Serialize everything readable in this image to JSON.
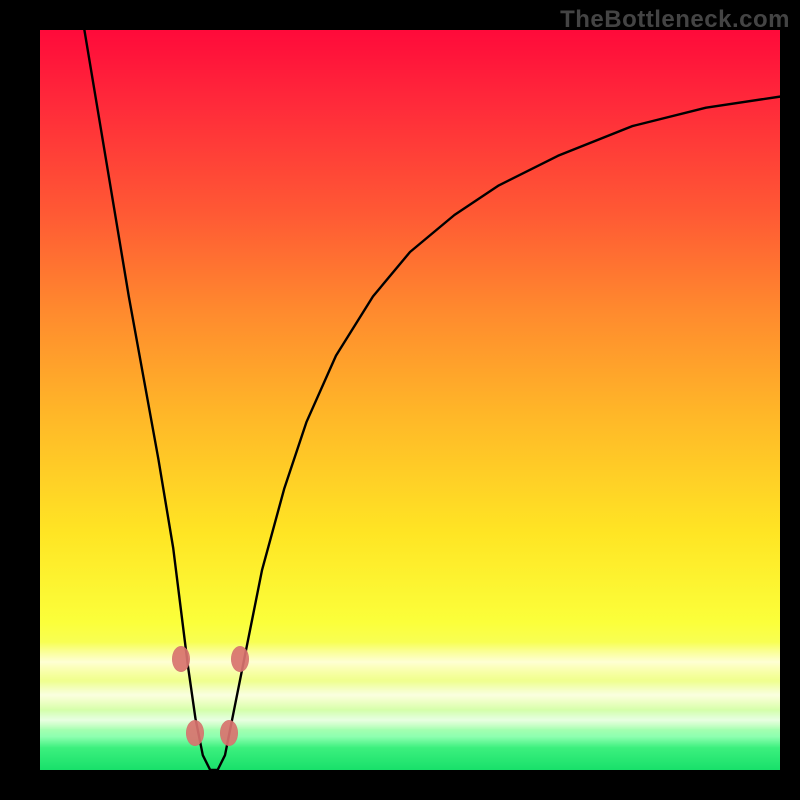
{
  "watermark": "TheBottleneck.com",
  "chart_data": {
    "type": "line",
    "title": "",
    "xlabel": "",
    "ylabel": "",
    "xlim": [
      0,
      100
    ],
    "ylim": [
      0,
      100
    ],
    "grid": false,
    "legend": false,
    "series": [
      {
        "name": "curve",
        "x": [
          6,
          8,
          10,
          12,
          14,
          16,
          18,
          19,
          20,
          21,
          22,
          23,
          24,
          25,
          26,
          28,
          30,
          33,
          36,
          40,
          45,
          50,
          56,
          62,
          70,
          80,
          90,
          100
        ],
        "y": [
          100,
          88,
          76,
          64,
          53,
          42,
          30,
          22,
          14,
          7,
          2,
          0,
          0,
          2,
          7,
          17,
          27,
          38,
          47,
          56,
          64,
          70,
          75,
          79,
          83,
          87,
          89.5,
          91
        ]
      }
    ],
    "markers": [
      {
        "name": "left-upper-dot",
        "x": 19.0,
        "y": 15
      },
      {
        "name": "right-upper-dot",
        "x": 27.0,
        "y": 15
      },
      {
        "name": "left-lower-dot",
        "x": 21.0,
        "y": 5
      },
      {
        "name": "right-lower-dot",
        "x": 25.5,
        "y": 5
      }
    ],
    "colors": {
      "curve": "#000000",
      "marker": "#d9746f",
      "gradient_top": "#ff0a3a",
      "gradient_mid": "#ffe524",
      "gradient_bottom": "#18e06a"
    }
  }
}
